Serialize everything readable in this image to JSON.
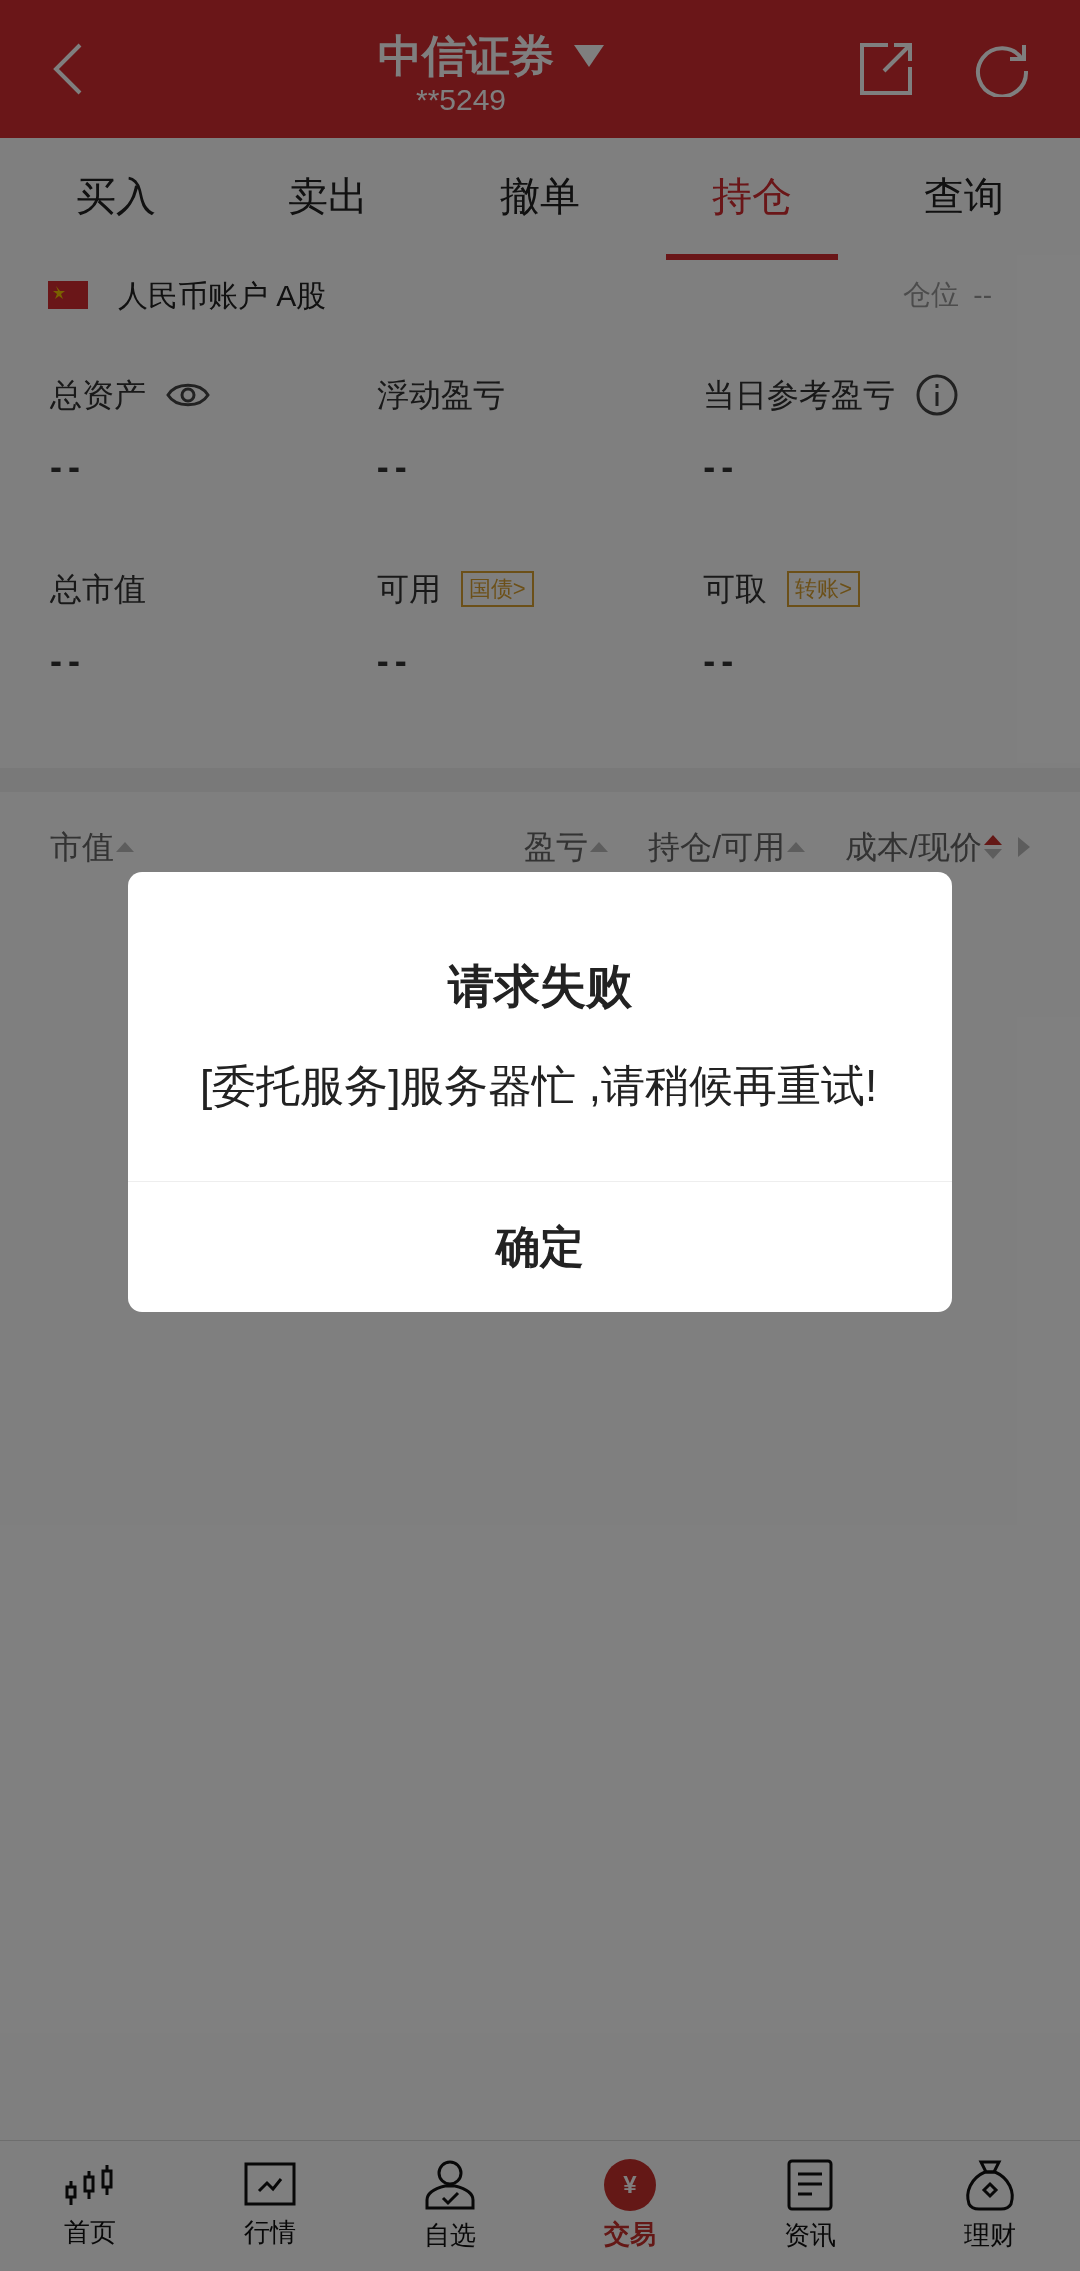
{
  "header": {
    "title": "中信证券",
    "account": "**5249"
  },
  "tabs": [
    {
      "label": "买入",
      "selected": false
    },
    {
      "label": "卖出",
      "selected": false
    },
    {
      "label": "撤单",
      "selected": false
    },
    {
      "label": "持仓",
      "selected": true
    },
    {
      "label": "查询",
      "selected": false
    }
  ],
  "account_bar": {
    "label": "人民币账户 A股",
    "position_label": "仓位",
    "position_value": "--"
  },
  "stats": [
    {
      "label": "总资产",
      "value": "--",
      "kind": "eye"
    },
    {
      "label": "浮动盈亏",
      "value": "--",
      "kind": "plain"
    },
    {
      "label": "当日参考盈亏",
      "value": "--",
      "kind": "info"
    },
    {
      "label": "总市值",
      "value": "--",
      "kind": "plain"
    },
    {
      "label": "可用",
      "value": "--",
      "kind": "tag",
      "tag": "国债>"
    },
    {
      "label": "可取",
      "value": "--",
      "kind": "tag",
      "tag": "转账>"
    }
  ],
  "table": {
    "columns": [
      {
        "label": "市值",
        "sorted": false
      },
      {
        "label": "盈亏",
        "sorted": false
      },
      {
        "label": "持仓/可用",
        "sorted": false
      },
      {
        "label": "成本/现价",
        "sorted": true
      }
    ]
  },
  "dialog": {
    "title": "请求失败",
    "message": "[委托服务]服务器忙 ,请稍候再重试!",
    "button": "确定"
  },
  "bottom_nav": [
    {
      "label": "首页",
      "selected": false,
      "kind": "candles"
    },
    {
      "label": "行情",
      "selected": false,
      "kind": "chart"
    },
    {
      "label": "自选",
      "selected": false,
      "kind": "person"
    },
    {
      "label": "交易",
      "selected": true,
      "kind": "trade",
      "icon_text": "¥"
    },
    {
      "label": "资讯",
      "selected": false,
      "kind": "doc"
    },
    {
      "label": "理财",
      "selected": false,
      "kind": "bag"
    }
  ]
}
